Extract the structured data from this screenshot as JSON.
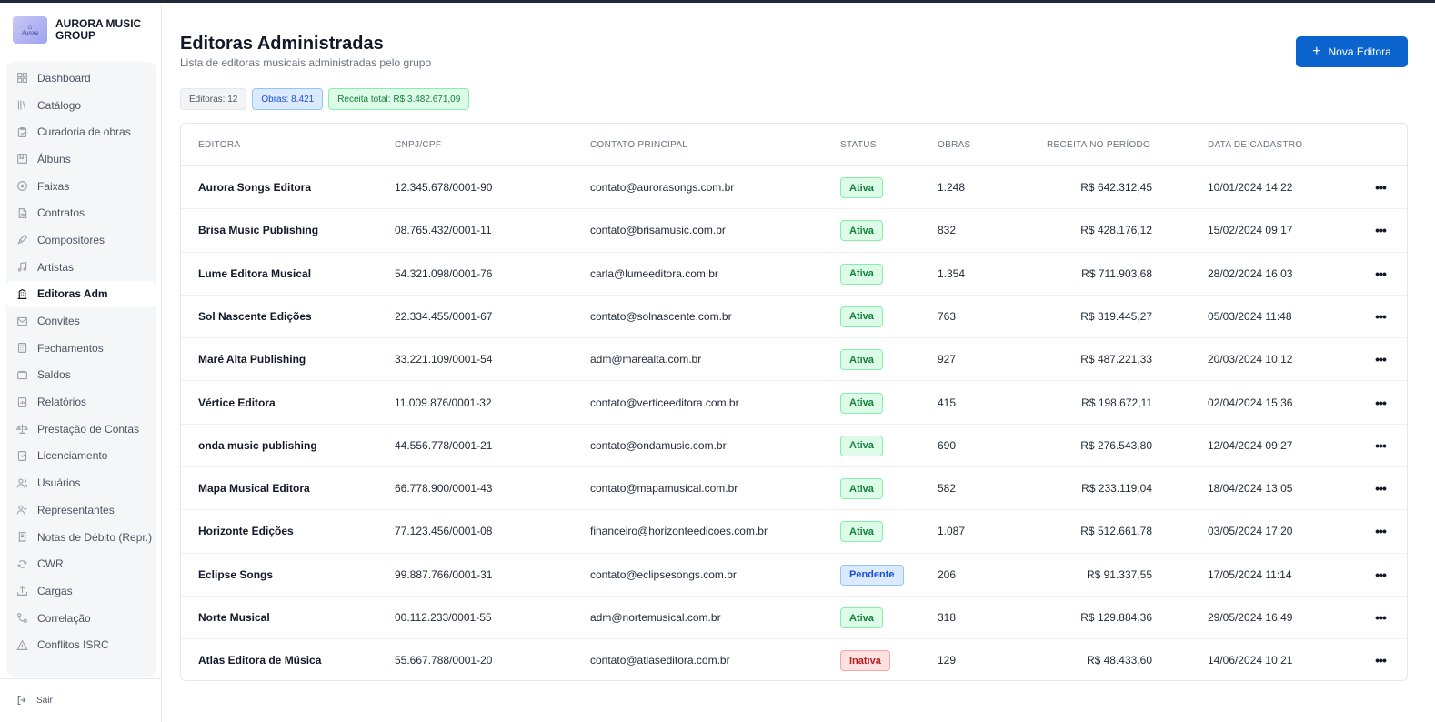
{
  "brand": {
    "name": "AURORA MUSIC GROUP",
    "logo_text": "Aurora"
  },
  "sidebar": {
    "items": [
      {
        "label": "Dashboard",
        "icon": "grid-icon",
        "active": false
      },
      {
        "label": "Catálogo",
        "icon": "library-icon",
        "active": false
      },
      {
        "label": "Curadoria de obras",
        "icon": "clipboard-check-icon",
        "active": false
      },
      {
        "label": "Álbuns",
        "icon": "album-icon",
        "active": false
      },
      {
        "label": "Faixas",
        "icon": "disc-icon",
        "active": false
      },
      {
        "label": "Contratos",
        "icon": "document-icon",
        "active": false
      },
      {
        "label": "Compositores",
        "icon": "pen-tool-icon",
        "active": false
      },
      {
        "label": "Artistas",
        "icon": "music-note-icon",
        "active": false
      },
      {
        "label": "Editoras Adm",
        "icon": "building-icon",
        "active": true
      },
      {
        "label": "Convites",
        "icon": "mail-icon",
        "active": false
      },
      {
        "label": "Fechamentos",
        "icon": "calculator-icon",
        "active": false
      },
      {
        "label": "Saldos",
        "icon": "wallet-icon",
        "active": false
      },
      {
        "label": "Relatórios",
        "icon": "report-icon",
        "active": false
      },
      {
        "label": "Prestação de Contas",
        "icon": "scale-icon",
        "active": false
      },
      {
        "label": "Licenciamento",
        "icon": "license-icon",
        "active": false
      },
      {
        "label": "Usuários",
        "icon": "users-icon",
        "active": false
      },
      {
        "label": "Representantes",
        "icon": "user-plus-icon",
        "active": false
      },
      {
        "label": "Notas de Débito (Repr.)",
        "icon": "receipt-icon",
        "active": false
      },
      {
        "label": "CWR",
        "icon": "refresh-icon",
        "active": false
      },
      {
        "label": "Cargas",
        "icon": "upload-icon",
        "active": false
      },
      {
        "label": "Correlação",
        "icon": "link-icon",
        "active": false
      },
      {
        "label": "Conflitos ISRC",
        "icon": "warning-icon",
        "active": false
      }
    ],
    "logout_label": "Sair"
  },
  "header": {
    "title": "Editoras Administradas",
    "subtitle": "Lista de editoras musicais administradas pelo grupo",
    "new_button_label": "Nova Editora"
  },
  "summary": {
    "editoras": "Editoras: 12",
    "obras": "Obras: 8.421",
    "receita": "Receita total: R$ 3.482.671,09"
  },
  "table": {
    "columns": [
      "EDITORA",
      "CNPJ/CPF",
      "CONTATO PRINCIPAL",
      "STATUS",
      "OBRAS",
      "RECEITA NO PERÍODO",
      "DATA DE CADASTRO"
    ],
    "rows": [
      {
        "editora": "Aurora Songs Editora",
        "cnpj": "12.345.678/0001-90",
        "contato": "contato@aurorasongs.com.br",
        "status": "Ativa",
        "obras": "1.248",
        "receita": "R$ 642.312,45",
        "data": "10/01/2024 14:22"
      },
      {
        "editora": "Brisa Music Publishing",
        "cnpj": "08.765.432/0001-11",
        "contato": "contato@brisamusic.com.br",
        "status": "Ativa",
        "obras": "832",
        "receita": "R$ 428.176,12",
        "data": "15/02/2024 09:17"
      },
      {
        "editora": "Lume Editora Musical",
        "cnpj": "54.321.098/0001-76",
        "contato": "carla@lumeeditora.com.br",
        "status": "Ativa",
        "obras": "1.354",
        "receita": "R$ 711.903,68",
        "data": "28/02/2024 16:03"
      },
      {
        "editora": "Sol Nascente Edições",
        "cnpj": "22.334.455/0001-67",
        "contato": "contato@solnascente.com.br",
        "status": "Ativa",
        "obras": "763",
        "receita": "R$ 319.445,27",
        "data": "05/03/2024 11:48"
      },
      {
        "editora": "Maré Alta Publishing",
        "cnpj": "33.221.109/0001-54",
        "contato": "adm@marealta.com.br",
        "status": "Ativa",
        "obras": "927",
        "receita": "R$ 487.221,33",
        "data": "20/03/2024 10:12"
      },
      {
        "editora": "Vértice Editora",
        "cnpj": "11.009.876/0001-32",
        "contato": "contato@verticeeditora.com.br",
        "status": "Ativa",
        "obras": "415",
        "receita": "R$ 198.672,11",
        "data": "02/04/2024 15:36"
      },
      {
        "editora": "onda music publishing",
        "cnpj": "44.556.778/0001-21",
        "contato": "contato@ondamusic.com.br",
        "status": "Ativa",
        "obras": "690",
        "receita": "R$ 276.543,80",
        "data": "12/04/2024 09:27"
      },
      {
        "editora": "Mapa Musical Editora",
        "cnpj": "66.778.900/0001-43",
        "contato": "contato@mapamusical.com.br",
        "status": "Ativa",
        "obras": "582",
        "receita": "R$ 233.119,04",
        "data": "18/04/2024 13:05"
      },
      {
        "editora": "Horizonte Edições",
        "cnpj": "77.123.456/0001-08",
        "contato": "financeiro@horizonteedicoes.com.br",
        "status": "Ativa",
        "obras": "1.087",
        "receita": "R$ 512.661,78",
        "data": "03/05/2024 17:20"
      },
      {
        "editora": "Eclipse Songs",
        "cnpj": "99.887.766/0001-31",
        "contato": "contato@eclipsesongs.com.br",
        "status": "Pendente",
        "obras": "206",
        "receita": "R$ 91.337,55",
        "data": "17/05/2024 11:14"
      },
      {
        "editora": "Norte Musical",
        "cnpj": "00.112.233/0001-55",
        "contato": "adm@nortemusical.com.br",
        "status": "Ativa",
        "obras": "318",
        "receita": "R$ 129.884,36",
        "data": "29/05/2024 16:49"
      },
      {
        "editora": "Atlas Editora de Música",
        "cnpj": "55.667.788/0001-20",
        "contato": "contato@atlaseditora.com.br",
        "status": "Inativa",
        "obras": "129",
        "receita": "R$ 48.433,60",
        "data": "14/06/2024 10:21"
      }
    ],
    "row_action_icon": "more-horizontal-icon"
  },
  "colors": {
    "primary": "#0b63ce",
    "active_green": "#15803d",
    "pending_blue": "#1d4ed8",
    "inactive_red": "#b91c1c"
  }
}
